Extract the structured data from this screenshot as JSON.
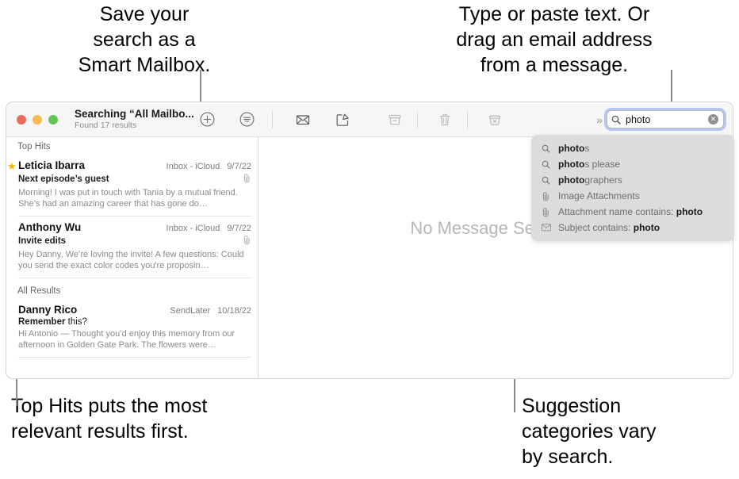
{
  "callouts": {
    "save_search": "Save your\nsearch as a\nSmart Mailbox.",
    "type_paste": "Type or paste text. Or\ndrag an email address\nfrom a message.",
    "top_hits": "Top Hits puts the most\nrelevant results first.",
    "suggestions": "Suggestion\ncategories vary\nby search."
  },
  "window": {
    "title": "Searching “All Mailbo...",
    "subtitle": "Found 17 results",
    "traffic_lights": {
      "close_color": "#ed6a5e",
      "minimize_color": "#f5bd4f",
      "zoom_color": "#61c454"
    }
  },
  "toolbar": {
    "add_smart_mailbox": "add-smart-mailbox",
    "filter": "filter",
    "mark_unread": "mark-unread",
    "compose": "compose",
    "archive": "archive",
    "delete": "delete",
    "junk": "junk",
    "overflow_label": "»"
  },
  "search": {
    "value": "photo",
    "clear_label": "✕",
    "icon": "search-icon"
  },
  "suggestions": [
    {
      "icon": "search-icon",
      "bold_prefix": "photo",
      "rest": "s",
      "suffix": "",
      "muted": false
    },
    {
      "icon": "search-icon",
      "bold_prefix": "photo",
      "rest": "s please",
      "suffix": "",
      "muted": false
    },
    {
      "icon": "search-icon",
      "bold_prefix": "photo",
      "rest": "graphers",
      "suffix": "",
      "muted": false
    },
    {
      "icon": "paperclip-icon",
      "bold_prefix": "",
      "rest": "Image Attachments",
      "suffix": "",
      "muted": true
    },
    {
      "icon": "paperclip-icon",
      "bold_prefix": "",
      "rest": "Attachment name contains: ",
      "suffix": "photo",
      "muted": true
    },
    {
      "icon": "envelope-icon",
      "bold_prefix": "",
      "rest": "Subject contains: ",
      "suffix": "photo",
      "muted": true
    }
  ],
  "message_list": {
    "sections": [
      {
        "label": "Top Hits",
        "messages": [
          {
            "starred": true,
            "sender": "Leticia Ibarra",
            "mailbox": "Inbox - iCloud",
            "date": "9/7/22",
            "subject_bold": "Next episode’s guest",
            "subject_rest": "",
            "has_attachment": true,
            "preview": "Morning! I was put in touch with Tania by a mutual friend. She’s had an amazing career that has gone do…"
          },
          {
            "starred": false,
            "sender": "Anthony Wu",
            "mailbox": "Inbox - iCloud",
            "date": "9/7/22",
            "subject_bold": "Invite edits",
            "subject_rest": "",
            "has_attachment": true,
            "preview": "Hey Danny, We’re loving the invite! A few questions: Could you send the exact color codes you're proposin…"
          }
        ]
      },
      {
        "label": "All Results",
        "messages": [
          {
            "starred": false,
            "sender": "Danny Rico",
            "mailbox": "SendLater",
            "date": "10/18/22",
            "subject_bold": "Remember",
            "subject_rest": " this?",
            "has_attachment": false,
            "preview": "Hi Antonio — Thought you’d enjoy this memory from our afternoon in Golden Gate Park. The flowers were…"
          }
        ]
      }
    ]
  },
  "detail": {
    "empty_state": "No Message Selected"
  }
}
